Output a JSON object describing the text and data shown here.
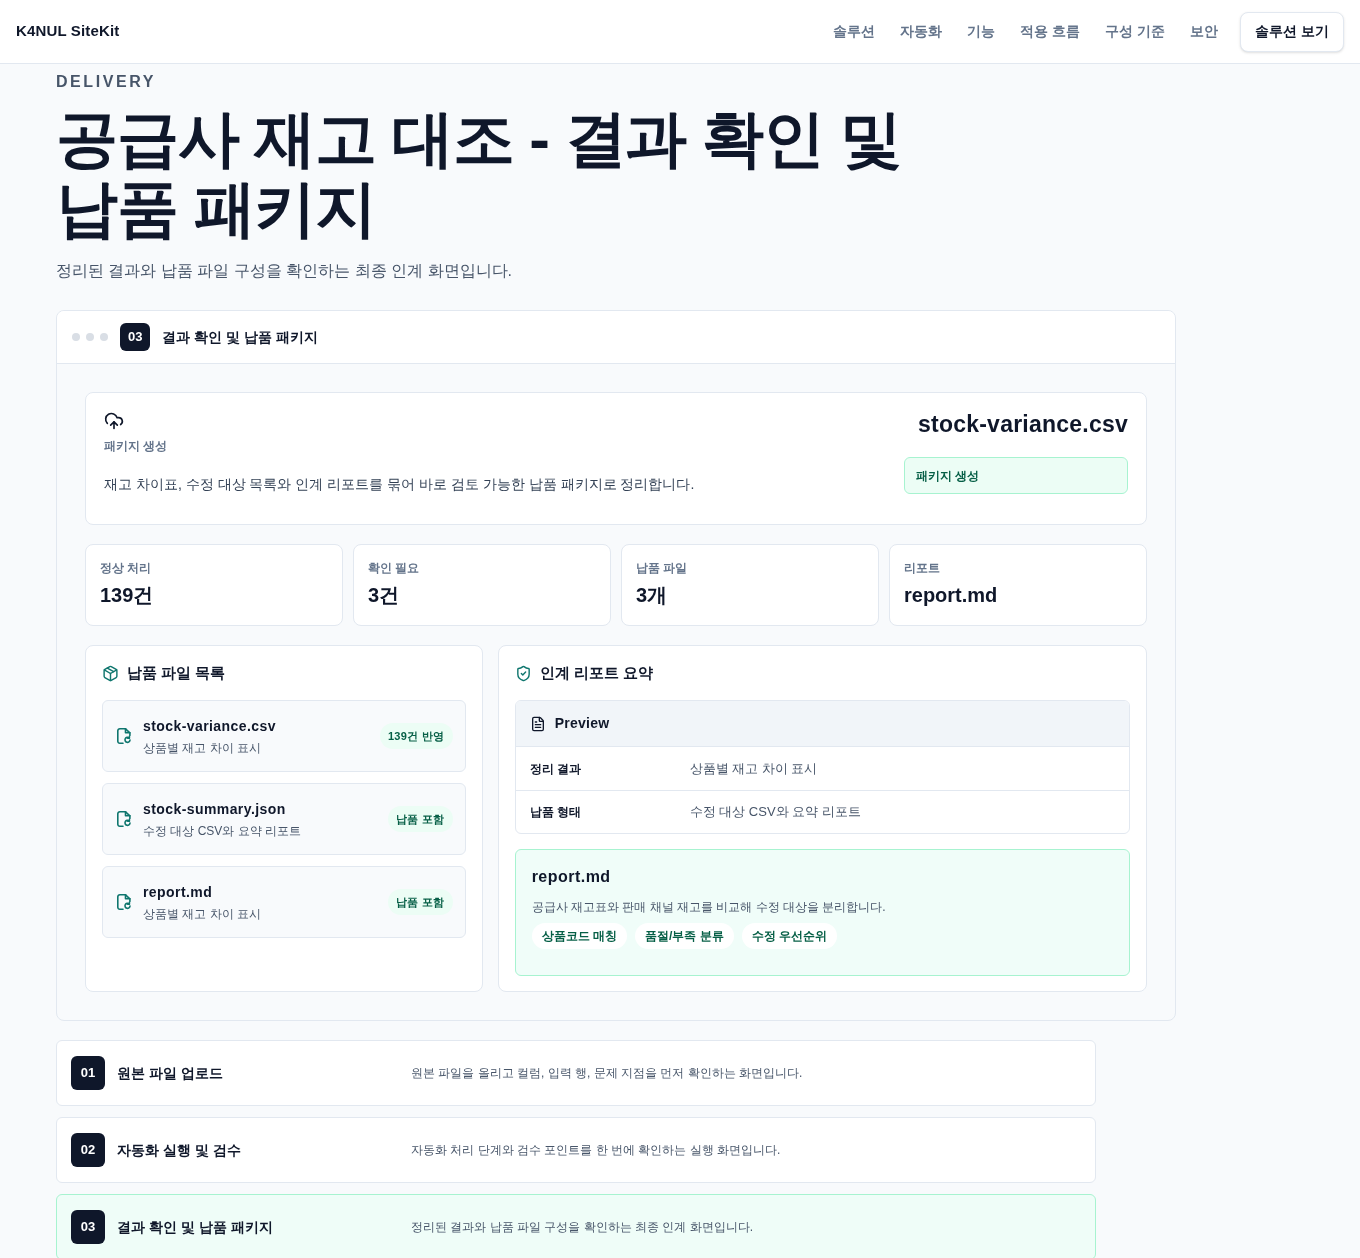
{
  "header": {
    "logo": "K4NUL SiteKit",
    "nav": [
      "솔루션",
      "자동화",
      "기능",
      "적용 흐름",
      "구성 기준",
      "보안"
    ],
    "cta": "솔루션 보기"
  },
  "hero": {
    "eyebrow": "DELIVERY",
    "title": "공급사 재고 대조 - 결과 확인 및 납품 패키지",
    "subtitle": "정리된 결과와 납품 파일 구성을 확인하는 최종 인계 화면입니다."
  },
  "panel": {
    "step": "03",
    "title": "결과 확인 및 납품 패키지",
    "package": {
      "label": "패키지 생성",
      "description": "재고 차이표, 수정 대상 목록와 인계 리포트를 묶어 바로 검토 가능한 납품 패키지로 정리합니다.",
      "file": "stock-variance.csv",
      "status": "패키지 생성"
    },
    "stats": [
      {
        "label": "정상 처리",
        "value": "139건"
      },
      {
        "label": "확인 필요",
        "value": "3건"
      },
      {
        "label": "납품 파일",
        "value": "3개"
      },
      {
        "label": "리포트",
        "value": "report.md"
      }
    ],
    "file_list": {
      "title": "납품 파일 목록",
      "files": [
        {
          "name": "stock-variance.csv",
          "description": "상품별 재고 차이 표시",
          "badge": "139건 반영"
        },
        {
          "name": "stock-summary.json",
          "description": "수정 대상 CSV와 요약 리포트",
          "badge": "납품 포함"
        },
        {
          "name": "report.md",
          "description": "상품별 재고 차이 표시",
          "badge": "납품 포함"
        }
      ]
    },
    "report_summary": {
      "title": "인계 리포트 요약",
      "preview": {
        "title": "Preview",
        "rows": [
          {
            "label": "정리 결과",
            "value": "상품별 재고 차이 표시"
          },
          {
            "label": "납품 형태",
            "value": "수정 대상 CSV와 요약 리포트"
          }
        ]
      },
      "report": {
        "name": "report.md",
        "description": "공급사 재고표와 판매 채널 재고를 비교해 수정 대상을 분리합니다.",
        "tags": [
          "상품코드 매칭",
          "품절/부족 분류",
          "수정 우선순위"
        ]
      }
    }
  },
  "steps": [
    {
      "number": "01",
      "title": "원본 파일 업로드",
      "description": "원본 파일을 올리고 컬럼, 입력 행, 문제 지점을 먼저 확인하는 화면입니다.",
      "selected": false
    },
    {
      "number": "02",
      "title": "자동화 실행 및 검수",
      "description": "자동화 처리 단계와 검수 포인트를 한 번에 확인하는 실행 화면입니다.",
      "selected": false
    },
    {
      "number": "03",
      "title": "결과 확인 및 납품 패키지",
      "description": "정리된 결과와 납품 파일 구성을 확인하는 최종 인계 화면입니다.",
      "selected": true
    }
  ]
}
